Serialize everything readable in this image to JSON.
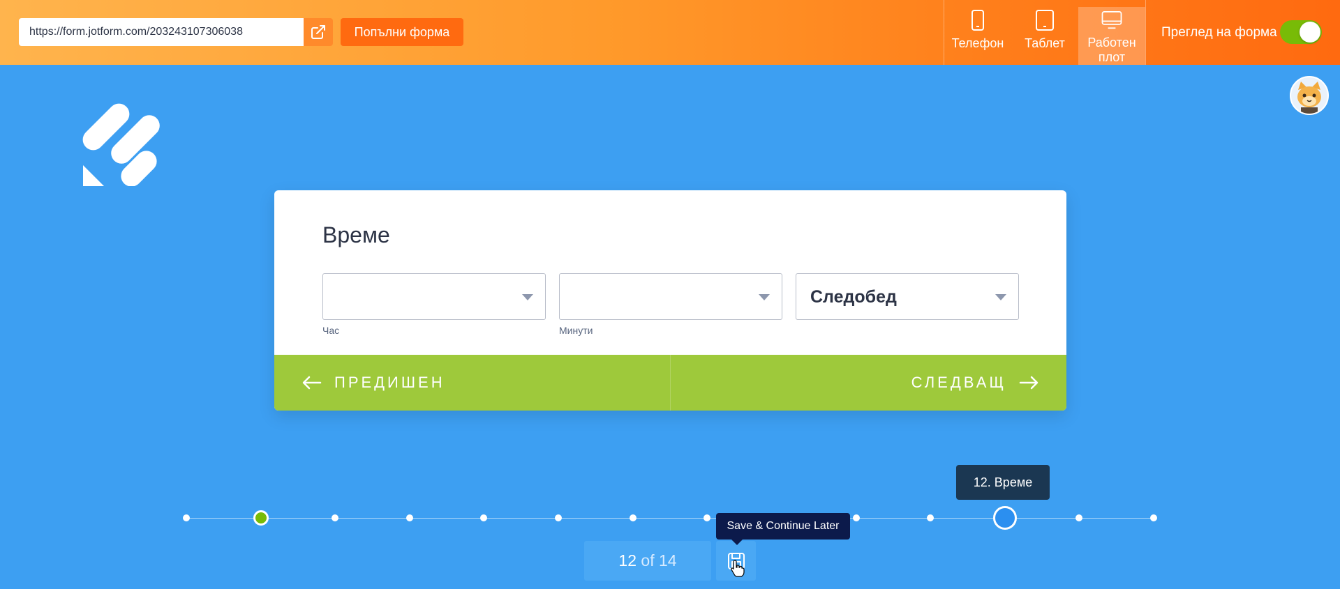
{
  "topbar": {
    "url": "https://form.jotform.com/203243107306038",
    "fill_label": "Попълни форма",
    "devices": [
      {
        "label": "Телефон",
        "icon": "phone-icon",
        "active": false
      },
      {
        "label": "Таблет",
        "icon": "tablet-icon",
        "active": false
      },
      {
        "label": "Работен плот",
        "icon": "desktop-icon",
        "active": true
      }
    ],
    "preview_label": "Преглед на форма",
    "preview_toggle_on": true
  },
  "form": {
    "question": "Време",
    "fields": [
      {
        "value": "",
        "sublabel": "Час"
      },
      {
        "value": "",
        "sublabel": "Минути"
      },
      {
        "value": "Следобед",
        "sublabel": ""
      }
    ],
    "prev_label": "ПРЕДИШЕН",
    "next_label": "СЛЕДВАЩ"
  },
  "progress": {
    "current_tooltip": "12. Време",
    "current": "12",
    "of_text": "of 14",
    "total_steps": 14,
    "current_step": 12,
    "completed_steps": [
      2
    ],
    "save_tooltip": "Save & Continue Later"
  },
  "colors": {
    "background": "#3d9ff2",
    "accent_orange": "#ff6a10",
    "nav_green": "#9ec93b",
    "done_green": "#78bb07",
    "tooltip_dark": "#1b3752"
  }
}
